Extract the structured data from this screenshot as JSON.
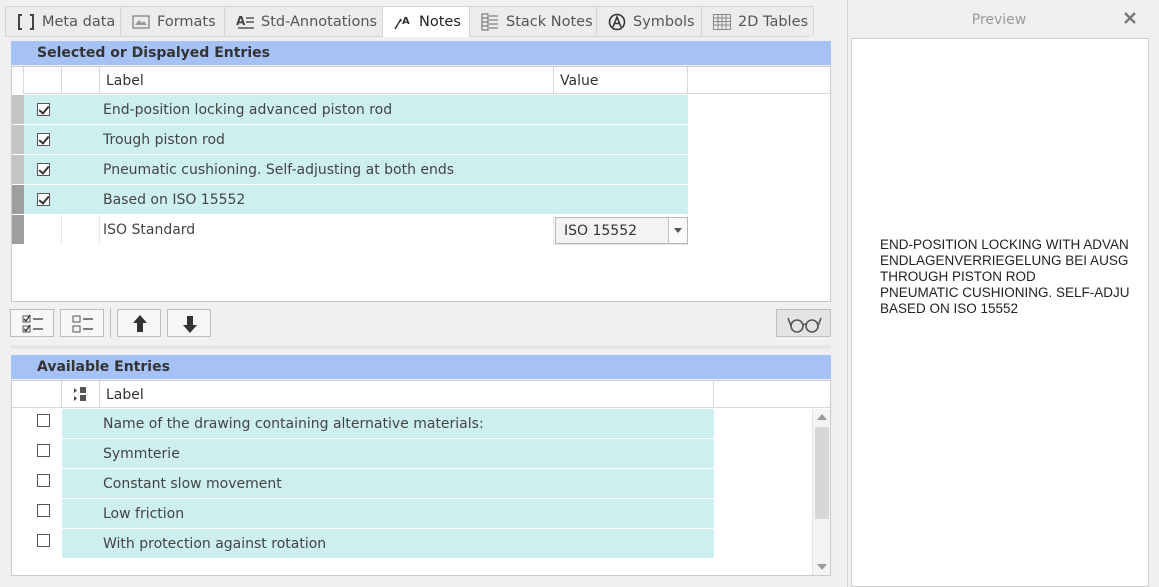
{
  "tabs": [
    {
      "label": "Meta data",
      "icon": "brackets-icon"
    },
    {
      "label": "Formats",
      "icon": "formats-icon"
    },
    {
      "label": "Std-Annotations",
      "icon": "annotation-icon"
    },
    {
      "label": "Notes",
      "icon": "notes-icon",
      "active": true
    },
    {
      "label": "Stack Notes",
      "icon": "stack-notes-icon"
    },
    {
      "label": "Symbols",
      "icon": "symbols-icon"
    },
    {
      "label": "2D Tables",
      "icon": "table-icon"
    }
  ],
  "selected": {
    "header": "Selected or Dispalyed Entries",
    "columns": {
      "label": "Label",
      "value": "Value"
    },
    "rows": [
      {
        "label": "End-position locking advanced piston rod",
        "checked": true
      },
      {
        "label": "Trough piston rod",
        "checked": true
      },
      {
        "label": "Pneumatic cushioning. Self-adjusting at both ends",
        "checked": true
      },
      {
        "label": "Based on ISO 15552",
        "checked": true
      }
    ],
    "editable_row": {
      "label": "ISO Standard",
      "value": "ISO 15552"
    }
  },
  "available": {
    "header": "Available Entries",
    "columns": {
      "label": "Label"
    },
    "rows": [
      {
        "label": "Name of the drawing containing alternative materials:",
        "checked": false
      },
      {
        "label": "Symmterie",
        "checked": false
      },
      {
        "label": "Constant slow movement",
        "checked": false
      },
      {
        "label": "Low friction",
        "checked": false
      },
      {
        "label": "With protection against rotation",
        "checked": false
      }
    ]
  },
  "preview": {
    "title": "Preview",
    "lines": [
      "END-POSITION LOCKING WITH ADVAN",
      "ENDLAGENVERRIEGELUNG BEI AUSG",
      "THROUGH PISTON ROD",
      "PNEUMATIC CUSHIONING. SELF-ADJU",
      "BASED ON ISO 15552"
    ]
  },
  "colors": {
    "header_bg": "#a6c2f5",
    "row_bg": "#cdeff0"
  }
}
